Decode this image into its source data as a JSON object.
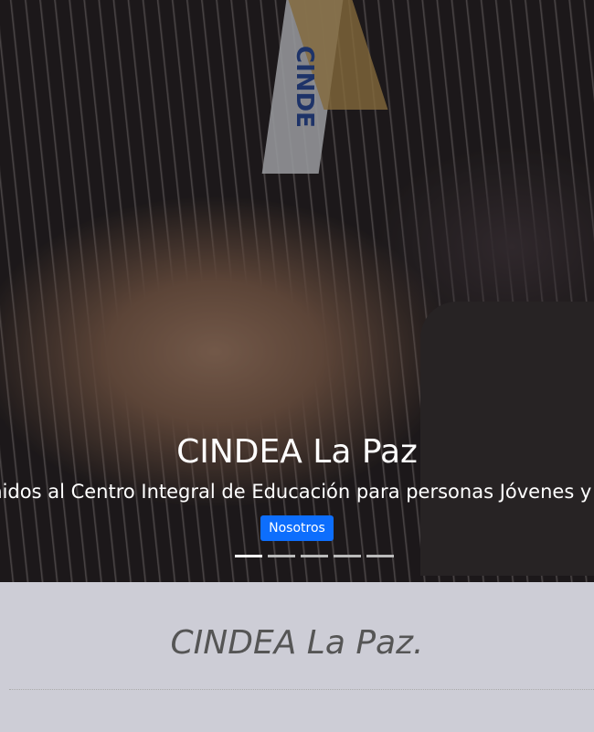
{
  "hero": {
    "lanyard_text": "CINDE",
    "title": "CINDEA La Paz",
    "subtitle": "Bienvenidos al Centro Integral de Educación para personas Jóvenes y Adultas",
    "button_label": "Nosotros",
    "indicators": 5,
    "active_indicator": 0
  },
  "section": {
    "heading": "CINDEA La Paz."
  }
}
